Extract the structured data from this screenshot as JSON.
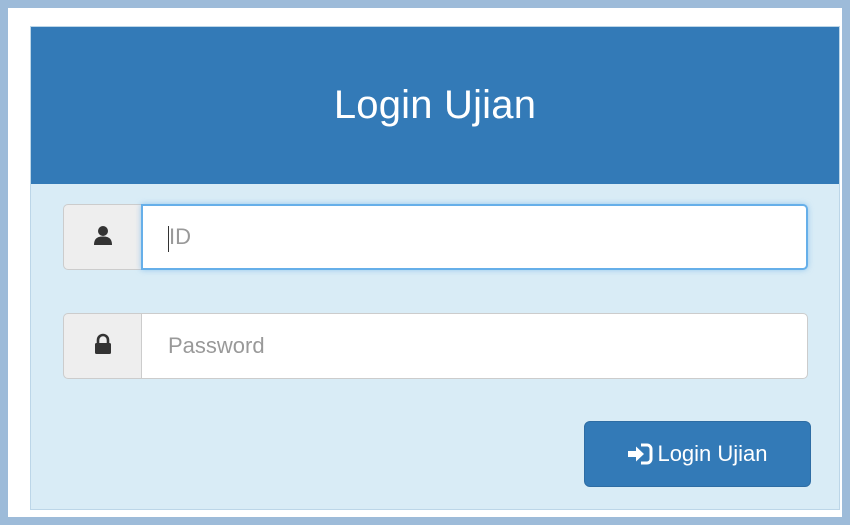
{
  "login_panel": {
    "title": "Login Ujian",
    "id_field": {
      "placeholder": "ID",
      "value": "",
      "icon": "user-icon"
    },
    "password_field": {
      "placeholder": "Password",
      "value": "",
      "icon": "lock-icon"
    },
    "submit_button": {
      "label": "Login Ujian",
      "icon": "log-in-icon"
    }
  },
  "colors": {
    "heading_bg": "#337ab7",
    "panel_bg": "#d9ecf6",
    "outer_bg": "#9dbbd9",
    "button_bg": "#337ab7",
    "focus_border": "#66afe9"
  }
}
